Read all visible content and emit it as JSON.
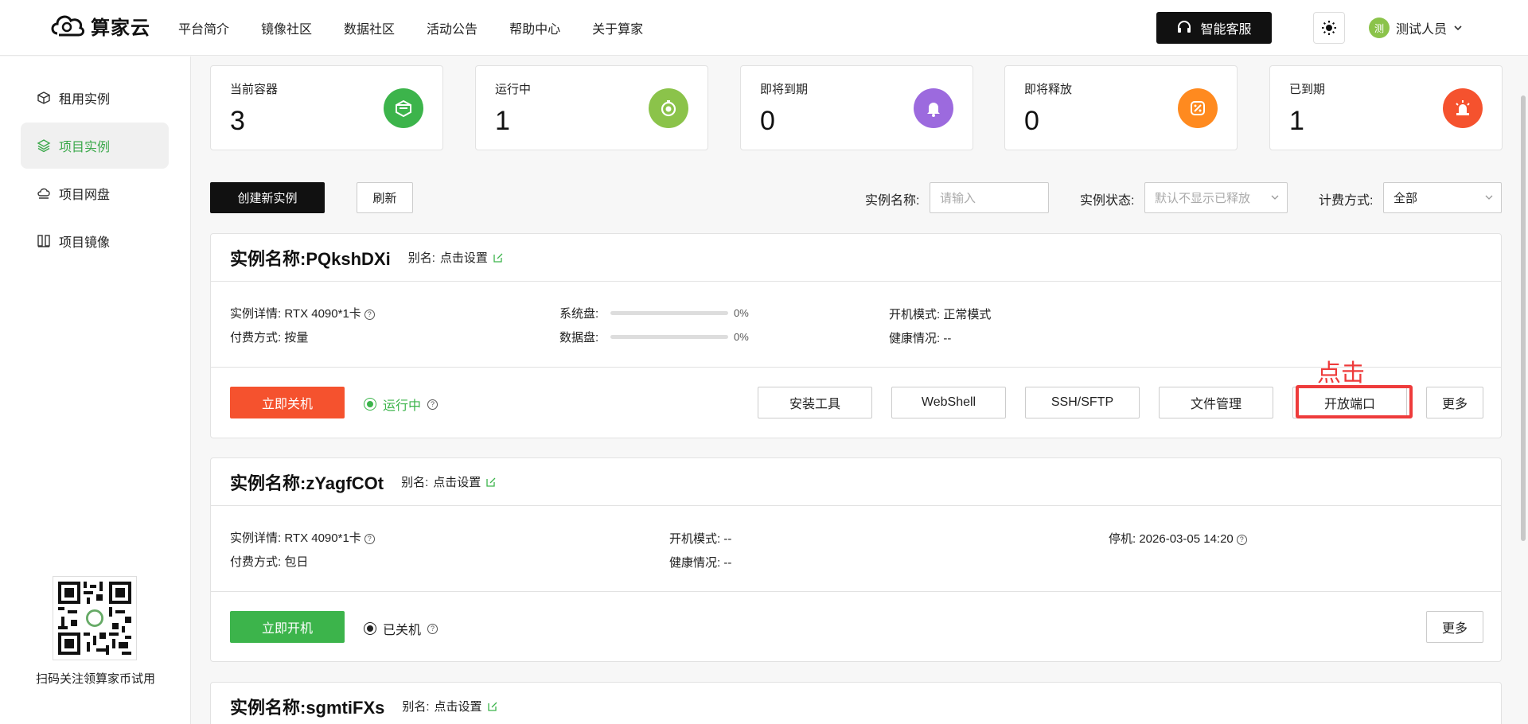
{
  "header": {
    "brand": "算家云",
    "nav": [
      "平台简介",
      "镜像社区",
      "数据社区",
      "活动公告",
      "帮助中心",
      "关于算家"
    ],
    "service_label": "智能客服",
    "user_avatar": "测",
    "user_name": "测试人员"
  },
  "sidebar": {
    "items": [
      {
        "label": "租用实例",
        "icon": "cube-icon"
      },
      {
        "label": "项目实例",
        "icon": "layers-icon"
      },
      {
        "label": "项目网盘",
        "icon": "cloud-drive-icon"
      },
      {
        "label": "项目镜像",
        "icon": "image-mirror-icon"
      }
    ],
    "qr_caption": "扫码关注领算家币试用"
  },
  "stats": [
    {
      "label": "当前容器",
      "value": "3",
      "color": "#3cb44b",
      "icon": "container-icon"
    },
    {
      "label": "运行中",
      "value": "1",
      "color": "#8bc34a",
      "icon": "timer-icon"
    },
    {
      "label": "即将到期",
      "value": "0",
      "color": "#9c6ade",
      "icon": "bell-icon"
    },
    {
      "label": "即将释放",
      "value": "0",
      "color": "#ff8a1f",
      "icon": "release-icon"
    },
    {
      "label": "已到期",
      "value": "1",
      "color": "#f5522e",
      "icon": "alarm-icon"
    }
  ],
  "toolbar": {
    "create_label": "创建新实例",
    "refresh_label": "刷新",
    "name_label": "实例名称:",
    "name_placeholder": "请输入",
    "status_label": "实例状态:",
    "status_placeholder": "默认不显示已释放",
    "billing_label": "计费方式:",
    "billing_value": "全部"
  },
  "instances": [
    {
      "title": "实例名称:PQkshDXi",
      "alias_label": "别名:",
      "alias_value": "点击设置",
      "detail_label": "实例详情:",
      "detail_value": "RTX 4090*1卡",
      "pay_label": "付费方式:",
      "pay_value": "按量",
      "sys_disk_label": "系统盘:",
      "sys_disk_pct": "0%",
      "data_disk_label": "数据盘:",
      "data_disk_pct": "0%",
      "boot_label": "开机模式:",
      "boot_value": "正常模式",
      "health_label": "健康情况:",
      "health_value": "--",
      "action_label": "立即关机",
      "status_label": "运行中",
      "buttons": [
        "安装工具",
        "WebShell",
        "SSH/SFTP",
        "文件管理",
        "开放端口",
        "更多"
      ]
    },
    {
      "title": "实例名称:zYagfCOt",
      "alias_label": "别名:",
      "alias_value": "点击设置",
      "detail_label": "实例详情:",
      "detail_value": "RTX 4090*1卡",
      "pay_label": "付费方式:",
      "pay_value": "包日",
      "boot_label": "开机模式:",
      "boot_value": "--",
      "health_label": "健康情况:",
      "health_value": "--",
      "stop_label": "停机:",
      "stop_value": "2026-03-05 14:20",
      "action_label": "立即开机",
      "status_label": "已关机",
      "more_label": "更多"
    },
    {
      "title": "实例名称:sgmtiFXs",
      "alias_label": "别名:",
      "alias_value": "点击设置"
    }
  ],
  "annotation": {
    "text": "点击",
    "color": "#ee3b3b"
  }
}
